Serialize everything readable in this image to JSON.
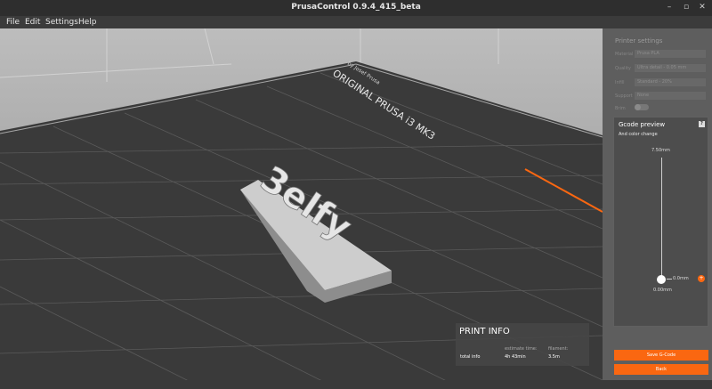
{
  "window": {
    "title": "PrusaControl 0.9.4_415_beta",
    "minimize": "–",
    "maximize": "▫",
    "close": "✕"
  },
  "menu": [
    "File",
    "Edit",
    "Settings",
    "Help"
  ],
  "viewport": {
    "bed_text_line1": "ORIGINAL PRUSA i3 MK3",
    "bed_text_line2": "by Josef Prusa",
    "model_text": "3elfy",
    "accent_color": "#fa6711",
    "grid_color": "#5a5a5a",
    "bed_color": "#3a3a3a"
  },
  "printer_settings": {
    "title": "Printer settings",
    "rows": [
      {
        "label": "Material",
        "value": "Prusa PLA"
      },
      {
        "label": "Quality",
        "value": "Ultra detail - 0.05 mm"
      },
      {
        "label": "Infill",
        "value": "Standard - 20%"
      },
      {
        "label": "Support",
        "value": "None"
      },
      {
        "label": "Brim",
        "value": ""
      }
    ]
  },
  "gcode_preview": {
    "title": "Gcode preview",
    "subtitle": "And color change",
    "help": "?",
    "top_value": "7.50mm",
    "current_layer": "0.0mm",
    "bottom_value": "0.00mm",
    "add_icon": "plus-icon"
  },
  "print_info": {
    "title": "PRINT INFO",
    "row_label": "total info",
    "col1_header": "estimate time:",
    "col1_value": "4h 43min",
    "col2_header": "filament:",
    "col2_value": "3.5m"
  },
  "buttons": {
    "save": "Save G-Code",
    "back": "Back"
  }
}
